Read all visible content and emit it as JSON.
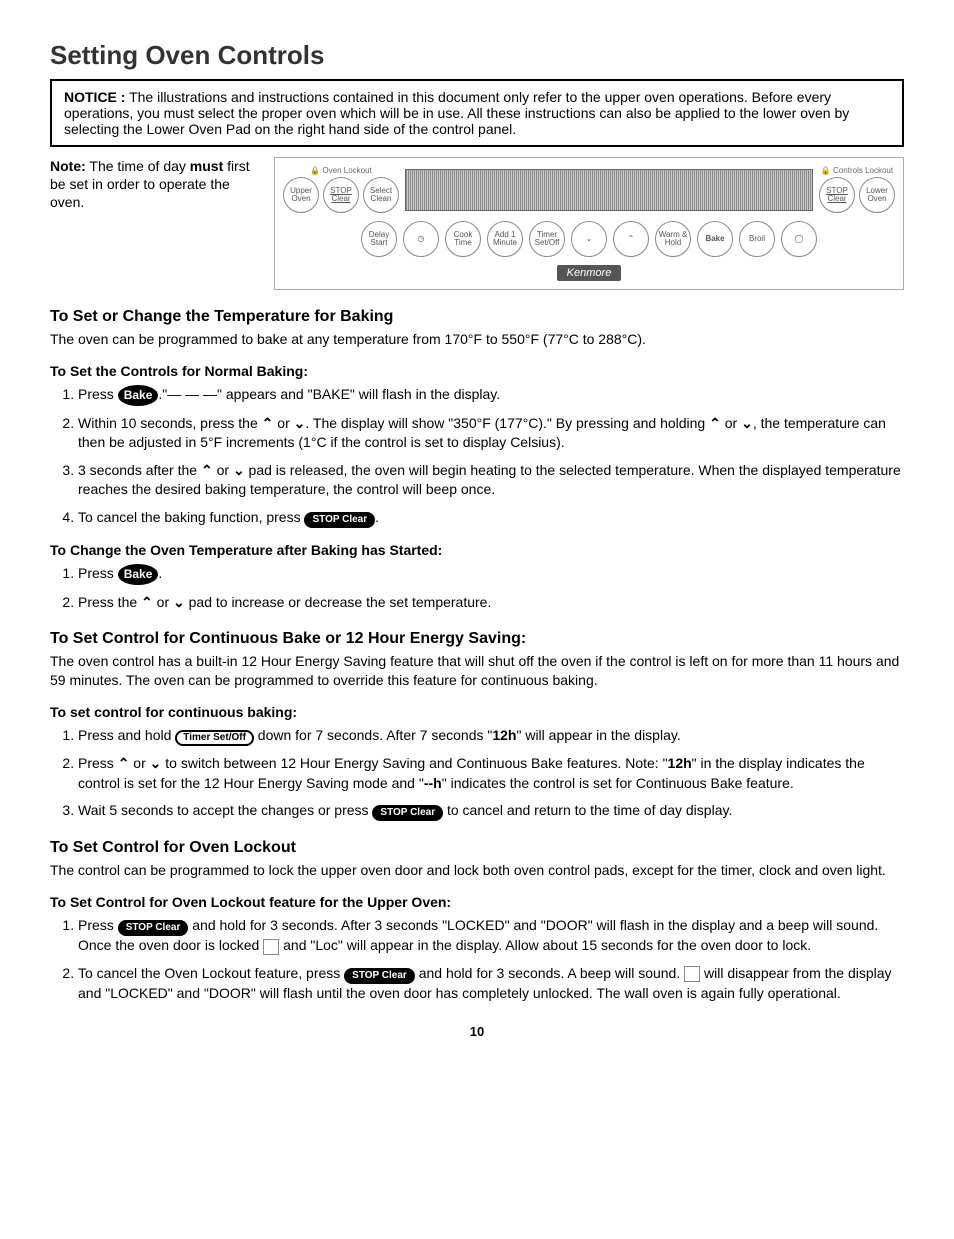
{
  "title": "Setting Oven Controls",
  "notice": {
    "label": "NOTICE :",
    "text": " The illustrations and instructions contained in this document only refer to the upper oven operations. Before every operations, you must select the proper oven which will be in use. All these instructions can also be applied to the lower oven by selecting the Lower Oven Pad on the right hand side of the control panel."
  },
  "note": {
    "label": "Note:",
    "text1": " The time of day ",
    "bold": "must",
    "text2": " first be set in order to operate the oven."
  },
  "panel": {
    "lock1": "🔒 Oven Lockout",
    "lock2": "🔒 Controls Lockout",
    "upper": "Upper Oven",
    "stop": "STOP Clear",
    "select": "Select Clean",
    "lower": "Lower Oven",
    "delay": "Delay Start",
    "clock": "◷",
    "cook": "Cook Time",
    "add1": "Add 1 Minute",
    "timer": "Timer Set/Off",
    "down": "⌄",
    "up": "⌃",
    "warm": "Warm & Hold",
    "bake": "Bake",
    "broil": "Broil",
    "light": "◯",
    "brand": "Kenmore"
  },
  "sec1": {
    "h": "To Set or Change the Temperature for Baking",
    "p": "The oven can be programmed to bake at any temperature from 170°F to 550°F (77°C to 288°C).",
    "h3a": "To Set the Controls for Normal Baking:",
    "li1a": "Press ",
    "li1pill": "Bake",
    "li1b": ".\"— — —\" appears and \"BAKE\" will flash in the display.",
    "li2a": "Within 10 seconds, press the ",
    "li2b": " or ",
    "li2c": ". The display will show \"350°F (177°C).\" By pressing and holding ",
    "li2d": " or ",
    "li2e": ", the temperature can then be adjusted in 5°F increments (1°C if the control is set to display Celsius).",
    "li3a": "3 seconds after the ",
    "li3b": " or ",
    "li3c": " pad is released, the oven will begin heating to the selected temperature. When the displayed temperature reaches the desired baking temperature, the control will beep once.",
    "li4a": "To cancel the baking function, press ",
    "li4pill": "STOP Clear",
    "li4b": ".",
    "h3b": "To Change the Oven Temperature after Baking has Started:",
    "li5a": "Press ",
    "li5pill": "Bake",
    "li5b": ".",
    "li6a": "Press the ",
    "li6b": " or ",
    "li6c": " pad to increase or decrease the set temperature."
  },
  "sec2": {
    "h": "To Set Control for Continuous Bake or 12 Hour Energy Saving:",
    "p": "The oven control has a built-in 12 Hour Energy Saving feature that will shut off the oven if the control is left on for more than 11 hours and 59 minutes. The oven can be programmed to override this feature for continuous baking.",
    "h3": "To set control for continuous baking:",
    "li1a": "Press and hold ",
    "li1pill": "Timer Set/Off",
    "li1b": " down for 7 seconds. After 7 seconds \"",
    "li1bold": "12h",
    "li1c": "\" will appear in the display.",
    "li2a": "Press ",
    "li2b": " or ",
    "li2c": " to switch between 12 Hour Energy Saving and Continuous Bake features. Note: \"",
    "li2bold1": "12h",
    "li2d": "\" in the display indicates the control is set for the 12 Hour Energy Saving mode and \"",
    "li2bold2": "--h",
    "li2e": "\" indicates the control is set for Continuous Bake feature.",
    "li3a": "Wait 5 seconds to accept the changes or press ",
    "li3pill": "STOP Clear",
    "li3b": " to cancel and return to the time of day display."
  },
  "sec3": {
    "h": "To Set Control for Oven Lockout",
    "p": "The control can be programmed to lock the upper oven door and lock both oven control pads, except for the timer, clock and oven light.",
    "h3": "To Set Control for Oven Lockout feature for the Upper Oven:",
    "li1a": "Press ",
    "li1pill": "STOP Clear",
    "li1b": " and hold for 3 seconds. After 3 seconds \"LOCKED\" and \"DOOR\" will flash in the display and a beep will sound. Once the oven door is locked ",
    "li1c": " and \"Loc\" will appear in the display. Allow about 15 seconds for the oven door to lock.",
    "li2a": "To cancel the Oven Lockout feature, press ",
    "li2pill": "STOP Clear",
    "li2b": " and hold for 3 seconds. A beep will sound. ",
    "li2c": " will disappear from the display and \"LOCKED\" and \"DOOR\" will flash until the oven door has completely unlocked. The wall oven is again fully operational."
  },
  "pagenum": "10",
  "arrows": {
    "up": "⌃",
    "down": "⌄"
  }
}
